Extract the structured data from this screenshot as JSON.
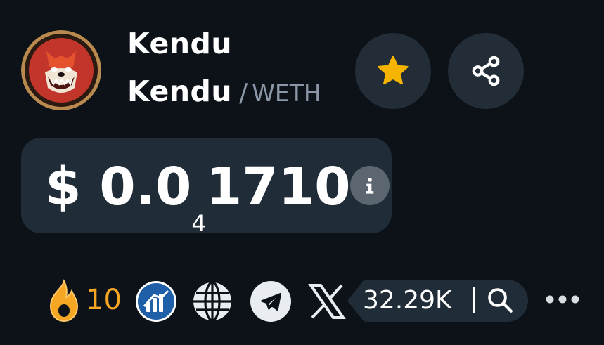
{
  "token": {
    "name": "Kendu",
    "base_symbol": "Kendu",
    "separator": "/",
    "quote_symbol": "WETH"
  },
  "price": {
    "currency": "$",
    "leading": "0.0",
    "zero_count": "4",
    "significant": "1710"
  },
  "social": {
    "fire_count": "10",
    "follower_count": "32.29K"
  },
  "icons": {
    "logo": "kendu-dog-logo",
    "favorite": "star-icon",
    "share": "share-icon",
    "info": "info-icon",
    "fire": "fire-icon",
    "stats": "bar-chart-icon",
    "website": "globe-icon",
    "telegram": "telegram-icon",
    "twitter": "x-icon",
    "search": "search-icon",
    "more": "more-dots-icon"
  },
  "colors": {
    "background": "#0c1217",
    "panel": "#202c38",
    "star": "#f5b400",
    "fire": "#f5a623",
    "muted": "#8b97a6"
  }
}
